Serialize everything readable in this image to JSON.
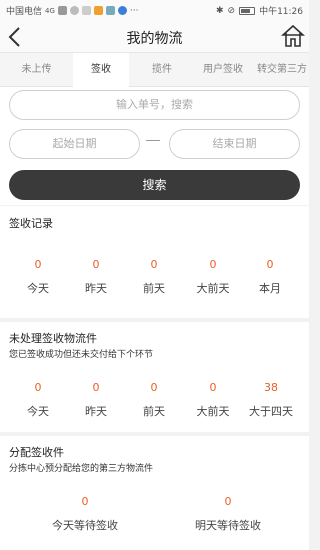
{
  "status_bar": {
    "carrier": "中国电信",
    "network": "4G",
    "battery": "68",
    "time": "中午11:26"
  },
  "nav": {
    "title": "我的物流"
  },
  "tabs": [
    "未上传",
    "签收",
    "揽件",
    "用户签收",
    "转交第三方"
  ],
  "active_tab": 1,
  "search": {
    "tracking_placeholder": "输入单号，搜索",
    "start_date_placeholder": "起始日期",
    "separator": "—",
    "end_date_placeholder": "结束日期",
    "search_label": "搜索"
  },
  "signed_records": {
    "title": "签收记录",
    "stats": [
      {
        "value": "0",
        "label": "今天"
      },
      {
        "value": "0",
        "label": "昨天"
      },
      {
        "value": "0",
        "label": "前天"
      },
      {
        "value": "0",
        "label": "大前天"
      },
      {
        "value": "0",
        "label": "本月"
      }
    ]
  },
  "unprocessed": {
    "title": "未处理签收物流件",
    "subtitle": "您已签收成功但还未交付给下个环节",
    "stats": [
      {
        "value": "0",
        "label": "今天"
      },
      {
        "value": "0",
        "label": "昨天"
      },
      {
        "value": "0",
        "label": "前天"
      },
      {
        "value": "0",
        "label": "大前天"
      },
      {
        "value": "38",
        "label": "大于四天"
      }
    ]
  },
  "assigned": {
    "title": "分配签收件",
    "subtitle": "分拣中心预分配给您的第三方物流件",
    "stats": [
      {
        "value": "0",
        "label": "今天等待签收"
      },
      {
        "value": "0",
        "label": "明天等待签收"
      }
    ]
  },
  "colors": {
    "accent_number": "#e8622a",
    "search_button": "#3a3a3a"
  }
}
